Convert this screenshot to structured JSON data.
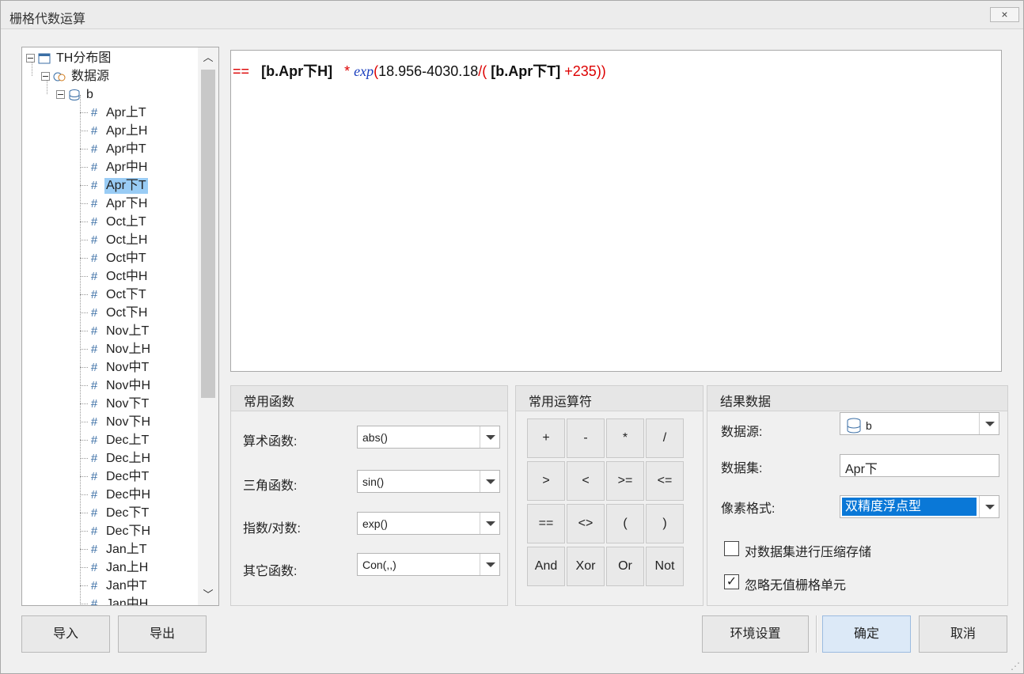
{
  "window": {
    "title": "栅格代数运算",
    "close_label": "×"
  },
  "tree": {
    "root": "TH分布图",
    "datasource": "数据源",
    "db": "b",
    "selected": "Apr下T",
    "items": [
      "Apr上T",
      "Apr上H",
      "Apr中T",
      "Apr中H",
      "Apr下T",
      "Apr下H",
      "Oct上T",
      "Oct上H",
      "Oct中T",
      "Oct中H",
      "Oct下T",
      "Oct下H",
      "Nov上T",
      "Nov上H",
      "Nov中T",
      "Nov中H",
      "Nov下T",
      "Nov下H",
      "Dec上T",
      "Dec上H",
      "Dec中T",
      "Dec中H",
      "Dec下T",
      "Dec下H",
      "Jan上T",
      "Jan上H",
      "Jan中T",
      "Jan中H"
    ]
  },
  "formula": {
    "eq": "==",
    "ref1": "[b.Apr下H]",
    "mul": "*",
    "fn": "exp",
    "open1": "(",
    "num1": "18.956-4030.18",
    "div": "/(",
    "ref2": "[b.Apr下T]",
    "plus": "+235",
    "close": "))"
  },
  "functions": {
    "header": "常用函数",
    "rows": [
      {
        "label": "算术函数:",
        "value": "abs()"
      },
      {
        "label": "三角函数:",
        "value": "sin()"
      },
      {
        "label": "指数/对数:",
        "value": "exp()"
      },
      {
        "label": "其它函数:",
        "value": "Con(,,)"
      }
    ]
  },
  "operators": {
    "header": "常用运算符",
    "buttons": [
      "+",
      "-",
      "*",
      "/",
      ">",
      "<",
      ">=",
      "<=",
      "==",
      "<>",
      "(",
      ")",
      "And",
      "Xor",
      "Or",
      "Not"
    ]
  },
  "result": {
    "header": "结果数据",
    "datasource_label": "数据源:",
    "datasource_value": "b",
    "dataset_label": "数据集:",
    "dataset_value": "Apr下",
    "pixel_label": "像素格式:",
    "pixel_value": "双精度浮点型",
    "compress_label": "对数据集进行压缩存储",
    "compress_checked": false,
    "ignore_label": "忽略无值栅格单元",
    "ignore_checked": true
  },
  "footer": {
    "import": "导入",
    "export": "导出",
    "env": "环境设置",
    "ok": "确定",
    "cancel": "取消"
  }
}
